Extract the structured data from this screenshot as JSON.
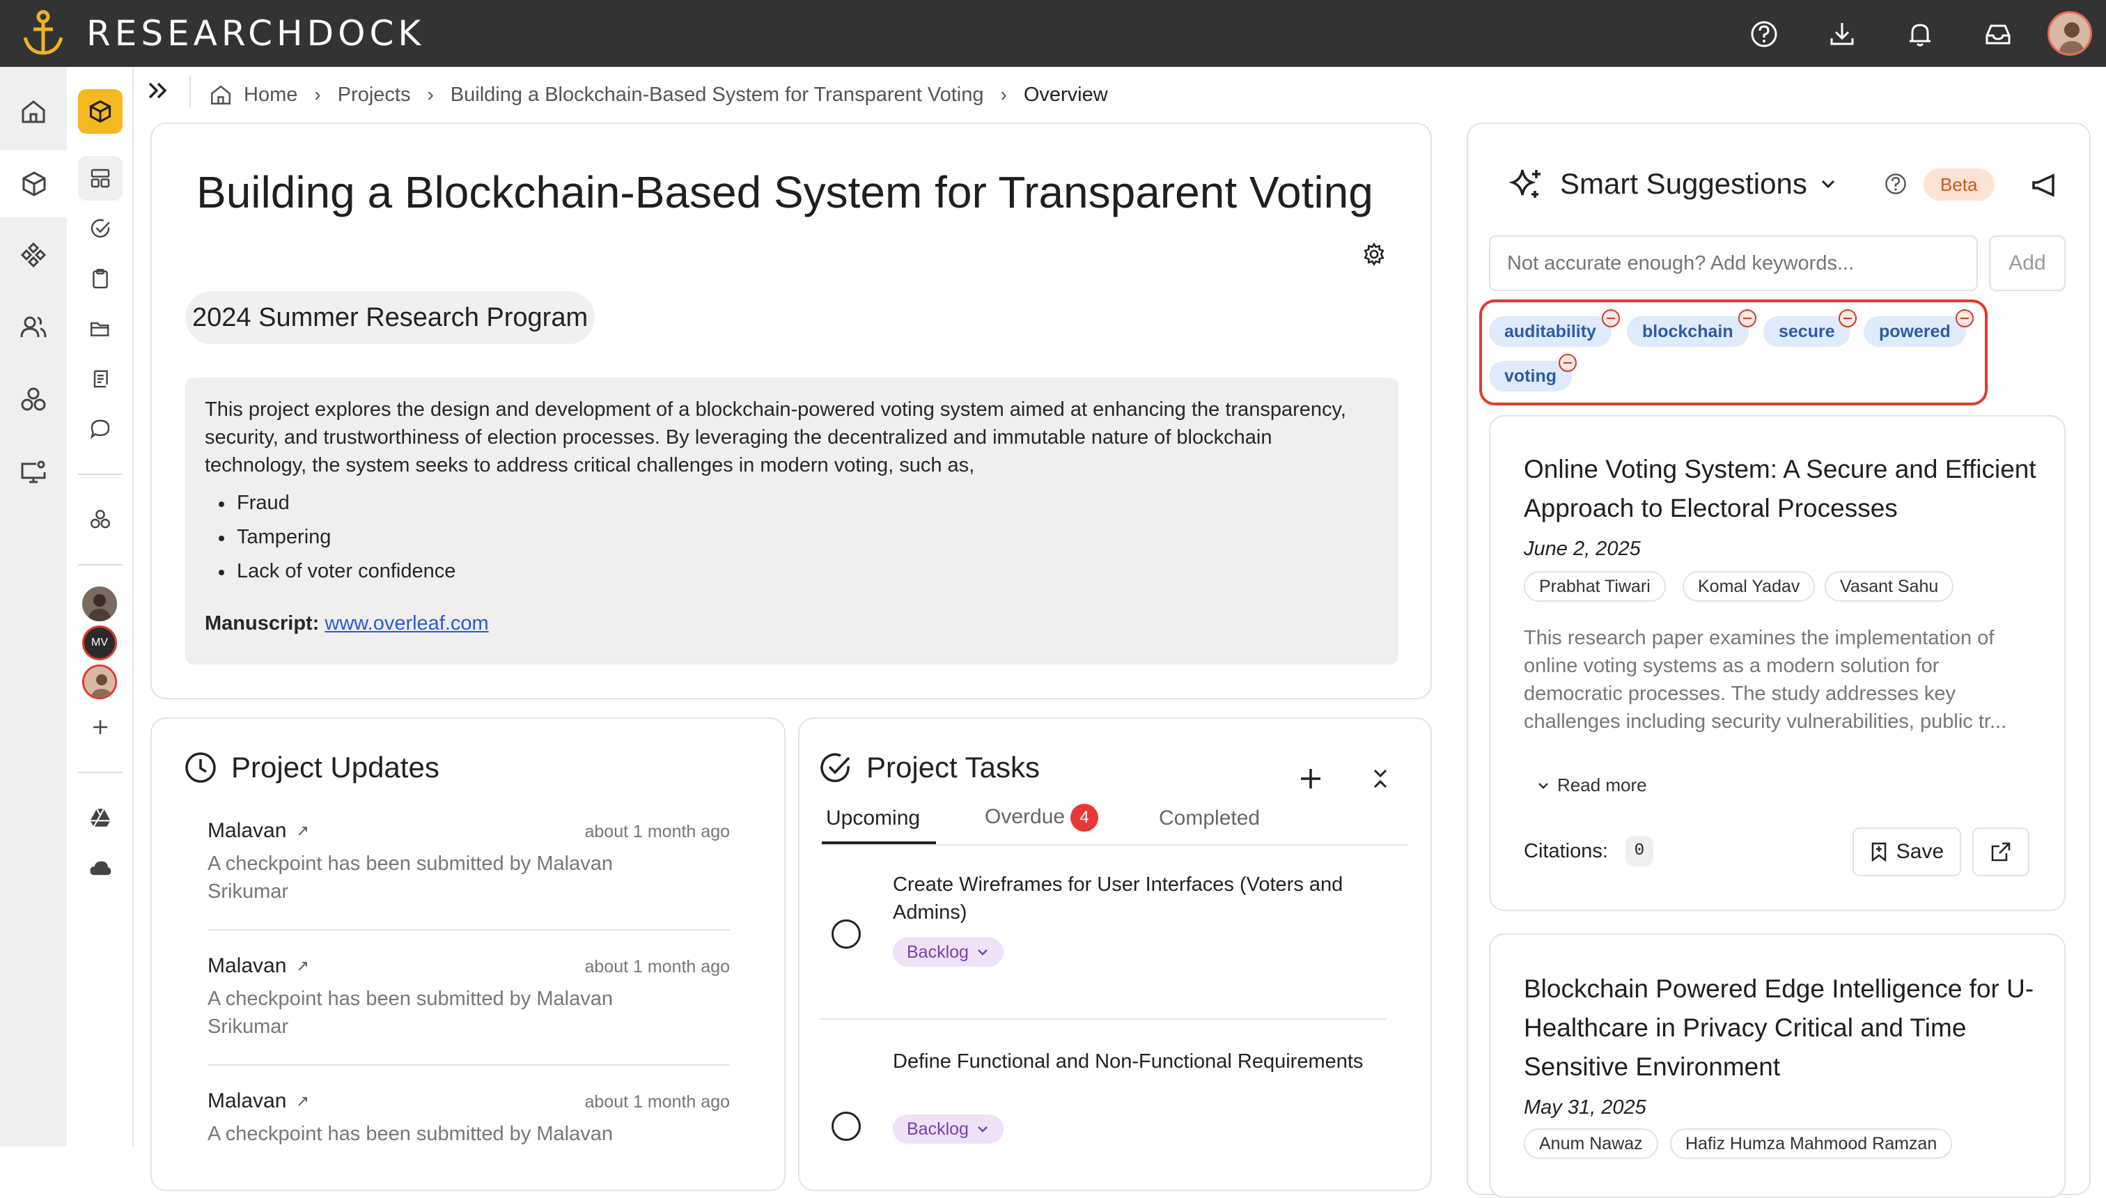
{
  "app": {
    "brand": "RESEARCHDOCK"
  },
  "breadcrumb": {
    "home": "Home",
    "projects": "Projects",
    "project": "Building a Blockchain-Based System for Transparent Voting",
    "current": "Overview"
  },
  "project": {
    "title": "Building a Blockchain-Based System for Transparent Voting",
    "program": "2024 Summer Research Program",
    "description": "This project explores the design and development of a blockchain-powered voting system aimed at enhancing the transparency, security, and trustworthiness of election processes. By leveraging the decentralized and immutable nature of blockchain technology, the system seeks to address critical challenges in modern voting, such as,",
    "bullets": [
      "Fraud",
      "Tampering",
      "Lack of voter confidence"
    ],
    "manuscript_label": "Manuscript:",
    "manuscript_link": "www.overleaf.com"
  },
  "updates": {
    "title": "Project Updates",
    "items": [
      {
        "name": "Malavan",
        "time": "about 1 month ago",
        "text": "A checkpoint has been submitted by Malavan Srikumar"
      },
      {
        "name": "Malavan",
        "time": "about 1 month ago",
        "text": "A checkpoint has been submitted by Malavan Srikumar"
      },
      {
        "name": "Malavan",
        "time": "about 1 month ago",
        "text": "A checkpoint has been submitted by Malavan"
      }
    ]
  },
  "tasks": {
    "title": "Project Tasks",
    "tabs": {
      "upcoming": "Upcoming",
      "overdue": "Overdue",
      "overdue_count": "4",
      "completed": "Completed"
    },
    "items": [
      {
        "title": "Create Wireframes for User Interfaces (Voters and Admins)",
        "status": "Backlog"
      },
      {
        "title": "Define Functional and Non-Functional Requirements",
        "status": "Backlog"
      }
    ]
  },
  "suggestions": {
    "title": "Smart Suggestions",
    "beta": "Beta",
    "input_placeholder": "Not accurate enough? Add keywords...",
    "add_label": "Add",
    "keywords": [
      "auditability",
      "blockchain",
      "secure",
      "powered",
      "voting"
    ],
    "papers": [
      {
        "title": "Online Voting System: A Secure and Efficient Approach to Electoral Processes",
        "date": "June 2, 2025",
        "authors": [
          "Prabhat Tiwari",
          "Komal Yadav",
          "Vasant Sahu"
        ],
        "abstract": "This research paper examines the implementation of online voting systems as a modern solution for democratic processes. The study addresses key challenges including security vulnerabilities, public tr...",
        "read_more": "Read more",
        "citations_label": "Citations:",
        "citations": "0",
        "save_label": "Save"
      },
      {
        "title": "Blockchain Powered Edge Intelligence for U-Healthcare in Privacy Critical and Time Sensitive Environment",
        "date": "May 31, 2025",
        "authors": [
          "Anum Nawaz",
          "Hafiz Humza Mahmood Ramzan"
        ]
      }
    ]
  },
  "sidebar": {
    "mini_avatar_initials": "MV"
  },
  "colors": {
    "topbar": "#333333",
    "accent_yellow": "#f5b820",
    "beta_bg": "#fde3d3",
    "chip_bg": "#dfeafb",
    "highlight_red": "#e23a2a",
    "overdue_badge": "#e53935"
  }
}
